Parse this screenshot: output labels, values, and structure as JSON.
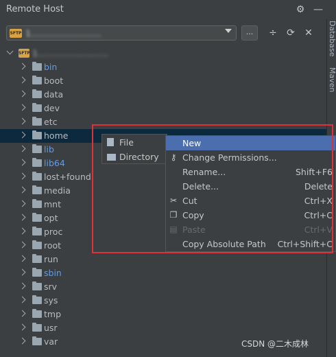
{
  "panel": {
    "title": "Remote Host"
  },
  "title_icons": [
    "gear-icon",
    "minimize-icon"
  ],
  "toolbar": {
    "host_value": "1..........................",
    "sftp_badge": "SFTP",
    "more_label": "...",
    "icons": [
      "collapse-icon",
      "refresh-icon",
      "close-icon"
    ]
  },
  "side_tabs": [
    "Database",
    "Maven"
  ],
  "tree": {
    "root_label": "1..........................",
    "folders": [
      {
        "name": "bin",
        "link": true
      },
      {
        "name": "boot",
        "link": false
      },
      {
        "name": "data",
        "link": false
      },
      {
        "name": "dev",
        "link": false
      },
      {
        "name": "etc",
        "link": false
      },
      {
        "name": "home",
        "link": false,
        "selected": true
      },
      {
        "name": "lib",
        "link": true
      },
      {
        "name": "lib64",
        "link": true
      },
      {
        "name": "lost+found",
        "link": false
      },
      {
        "name": "media",
        "link": false
      },
      {
        "name": "mnt",
        "link": false
      },
      {
        "name": "opt",
        "link": false
      },
      {
        "name": "proc",
        "link": false
      },
      {
        "name": "root",
        "link": false
      },
      {
        "name": "run",
        "link": false
      },
      {
        "name": "sbin",
        "link": true
      },
      {
        "name": "srv",
        "link": false
      },
      {
        "name": "sys",
        "link": false
      },
      {
        "name": "tmp",
        "link": false
      },
      {
        "name": "usr",
        "link": false
      },
      {
        "name": "var",
        "link": false
      }
    ]
  },
  "submenu": {
    "items": [
      "File",
      "Directory"
    ]
  },
  "context_menu": {
    "items": [
      {
        "label": "New",
        "shortcut": "",
        "icon": "",
        "active": true
      },
      {
        "label": "Change Permissions...",
        "shortcut": "",
        "icon": "key-icon"
      },
      {
        "label": "Rename...",
        "shortcut": "Shift+F6",
        "icon": ""
      },
      {
        "label": "Delete...",
        "shortcut": "Delete",
        "icon": ""
      },
      {
        "label": "Cut",
        "shortcut": "Ctrl+X",
        "icon": "scissors-icon"
      },
      {
        "label": "Copy",
        "shortcut": "Ctrl+C",
        "icon": "copy-icon"
      },
      {
        "label": "Paste",
        "shortcut": "Ctrl+V",
        "icon": "paste-icon",
        "disabled": true
      },
      {
        "label": "Copy Absolute Path",
        "shortcut": "Ctrl+Shift+C",
        "icon": ""
      }
    ]
  },
  "watermark": "CSDN @二木成林",
  "colors": {
    "accent": "#4b6eaf",
    "link": "#589df6",
    "highlight_box": "#e0303a",
    "selected_row": "#0d293e"
  }
}
